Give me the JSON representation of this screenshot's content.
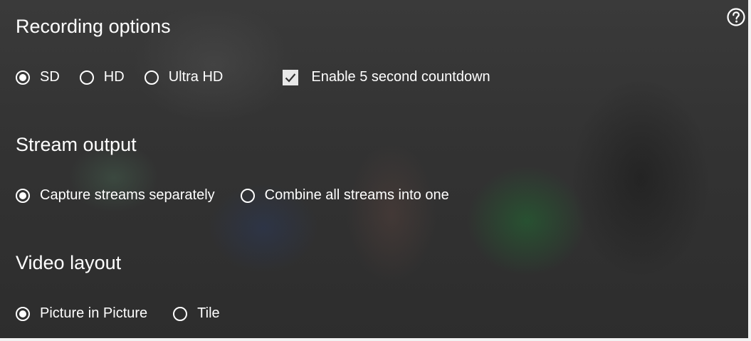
{
  "recording_options": {
    "title": "Recording options",
    "quality": [
      {
        "label": "SD",
        "selected": true
      },
      {
        "label": "HD",
        "selected": false
      },
      {
        "label": "Ultra HD",
        "selected": false
      }
    ],
    "countdown": {
      "label": "Enable 5 second countdown",
      "checked": true
    }
  },
  "stream_output": {
    "title": "Stream output",
    "options": [
      {
        "label": "Capture streams separately",
        "selected": true
      },
      {
        "label": "Combine all streams into one",
        "selected": false
      }
    ]
  },
  "video_layout": {
    "title": "Video layout",
    "options": [
      {
        "label": "Picture in Picture",
        "selected": true
      },
      {
        "label": "Tile",
        "selected": false
      }
    ]
  },
  "icons": {
    "help": "help-circle-icon"
  },
  "colors": {
    "text": "#ffffff",
    "checkbox_bg": "#e8e8e8"
  }
}
